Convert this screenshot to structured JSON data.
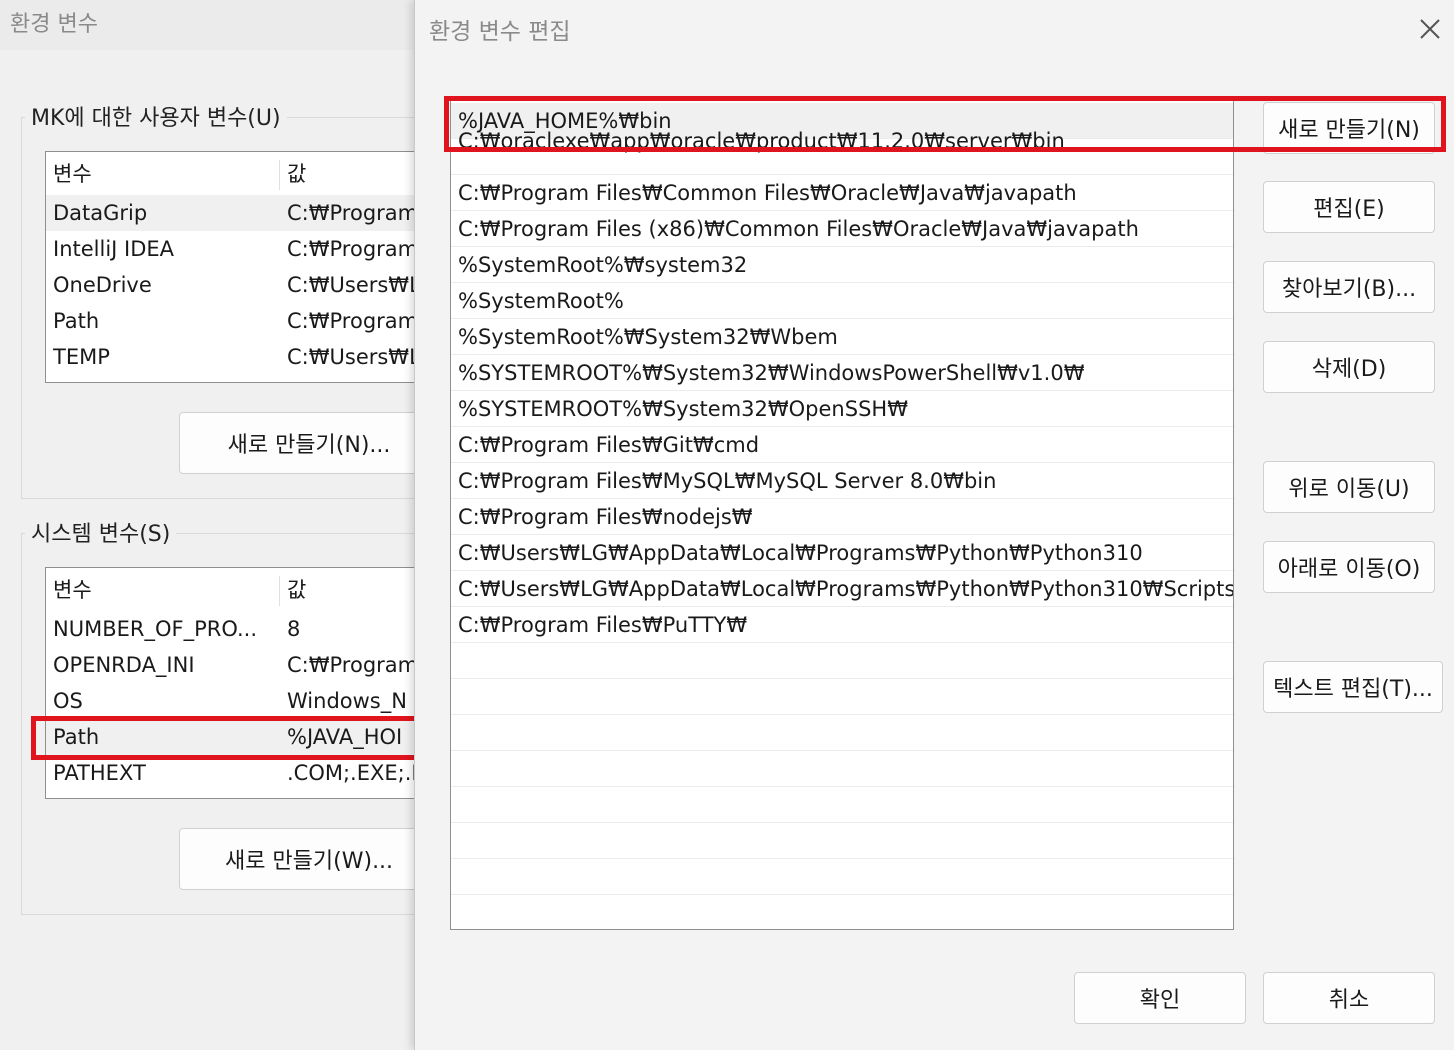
{
  "background_window": {
    "title": "환경 변수",
    "user_group_label": "MK에 대한 사용자 변수(U)",
    "system_group_label": "시스템 변수(S)",
    "columns": {
      "variable": "변수",
      "value": "값"
    },
    "user_vars": [
      {
        "name": "DataGrip",
        "value": "C:₩Program"
      },
      {
        "name": "IntelliJ IDEA",
        "value": "C:₩Program"
      },
      {
        "name": "OneDrive",
        "value": "C:₩Users₩L"
      },
      {
        "name": "Path",
        "value": "C:₩Program"
      },
      {
        "name": "TEMP",
        "value": "C:₩Users₩L"
      }
    ],
    "system_vars": [
      {
        "name": "NUMBER_OF_PRO...",
        "value": "8"
      },
      {
        "name": "OPENRDA_INI",
        "value": "C:₩Program"
      },
      {
        "name": "OS",
        "value": "Windows_N"
      },
      {
        "name": "Path",
        "value": "%JAVA_HOI"
      },
      {
        "name": "PATHEXT",
        "value": ".COM;.EXE;.E"
      }
    ],
    "user_new_button": "새로 만들기(N)...",
    "system_new_button": "새로 만들기(W)..."
  },
  "dialog": {
    "title": "환경 변수 편집",
    "entries": [
      "%JAVA_HOME%₩bin",
      "C:₩oraclexe₩app₩oracle₩product₩11.2.0₩server₩bin",
      "C:₩Program Files₩Common Files₩Oracle₩Java₩javapath",
      "C:₩Program Files (x86)₩Common Files₩Oracle₩Java₩javapath",
      "%SystemRoot%₩system32",
      "%SystemRoot%",
      "%SystemRoot%₩System32₩Wbem",
      "%SYSTEMROOT%₩System32₩WindowsPowerShell₩v1.0₩",
      "%SYSTEMROOT%₩System32₩OpenSSH₩",
      "C:₩Program Files₩Git₩cmd",
      "C:₩Program Files₩MySQL₩MySQL Server 8.0₩bin",
      "C:₩Program Files₩nodejs₩",
      "C:₩Users₩LG₩AppData₩Local₩Programs₩Python₩Python310",
      "C:₩Users₩LG₩AppData₩Local₩Programs₩Python₩Python310₩Scripts",
      "C:₩Program Files₩PuTTY₩"
    ],
    "buttons": {
      "new": "새로 만들기(N)",
      "edit": "편집(E)",
      "browse": "찾아보기(B)...",
      "delete": "삭제(D)",
      "move_up": "위로 이동(U)",
      "move_down": "아래로 이동(O)",
      "edit_text": "텍스트 편집(T)...",
      "ok": "확인",
      "cancel": "취소"
    }
  },
  "highlight_color": "#e0141c"
}
